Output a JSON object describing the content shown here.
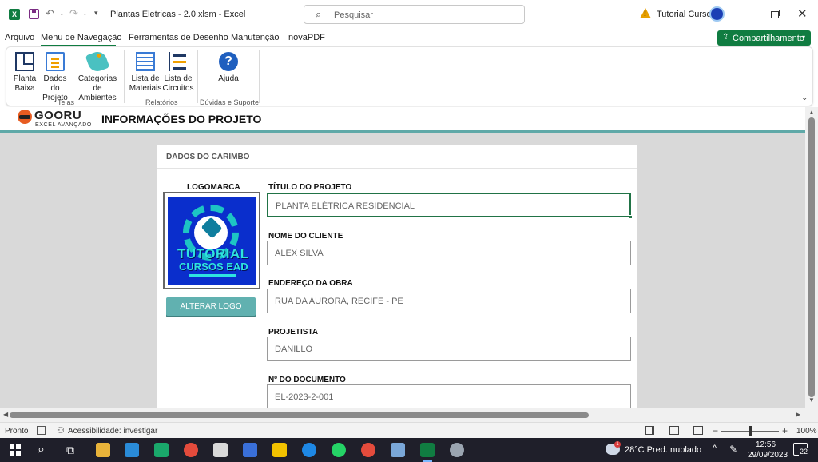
{
  "titlebar": {
    "document_title": "Plantas Eletricas - 2.0.xlsm  -  Excel",
    "search_placeholder": "Pesquisar",
    "account_name": "Tutorial Cursos",
    "close_glyph": "✕"
  },
  "tabs": [
    {
      "label": "Arquivo"
    },
    {
      "label": "Menu de Navegação"
    },
    {
      "label": "Ferramentas de Desenho"
    },
    {
      "label": "Manutenção"
    },
    {
      "label": "novaPDF"
    }
  ],
  "share_button": {
    "label": "Compartilhamento"
  },
  "ribbon": {
    "groups": [
      {
        "label": "Telas"
      },
      {
        "label": "Relatórios"
      },
      {
        "label": "Dúvidas e Suporte"
      }
    ],
    "buttons": {
      "planta_baixa": [
        "Planta",
        "Baixa"
      ],
      "dados_projeto": [
        "Dados do",
        "Projeto"
      ],
      "categorias": [
        "Categorias de",
        "Ambientes"
      ],
      "lista_materiais": [
        "Lista de",
        "Materiais"
      ],
      "lista_circuitos": [
        "Lista de",
        "Circuitos"
      ],
      "ajuda": [
        "Ajuda"
      ]
    }
  },
  "sheet": {
    "brand_name": "GOORU",
    "brand_sub": "EXCEL AVANÇADO",
    "page_heading": "INFORMAÇÕES DO PROJETO",
    "card_title": "DADOS DO CARIMBO",
    "logo_label": "LOGOMARCA",
    "logo_text_1": "TUTORIAL",
    "logo_text_2": "CURSOS EAD",
    "alter_logo_button": "ALTERAR LOGO",
    "fields": [
      {
        "label": "TÍTULO DO PROJETO",
        "value": "PLANTA ELÉTRICA RESIDENCIAL"
      },
      {
        "label": "NOME DO CLIENTE",
        "value": "ALEX SILVA"
      },
      {
        "label": "ENDEREÇO DA OBRA",
        "value": "RUA DA AURORA, RECIFE - PE"
      },
      {
        "label": "PROJETISTA",
        "value": "DANILLO"
      },
      {
        "label": "Nº DO DOCUMENTO",
        "value": "EL-2023-2-001"
      }
    ]
  },
  "statusbar": {
    "ready": "Pronto",
    "accessibility": "Acessibilidade: investigar",
    "zoom": "100%"
  },
  "taskbar": {
    "weather": "28°C  Pred. nublado",
    "weather_badge": "1",
    "time": "12:56",
    "date": "29/09/2023",
    "notifications": "22"
  },
  "colors": {
    "excel_green": "#107c41",
    "accent_teal": "#61b1b0",
    "logo_blue": "#0a2ecc"
  }
}
